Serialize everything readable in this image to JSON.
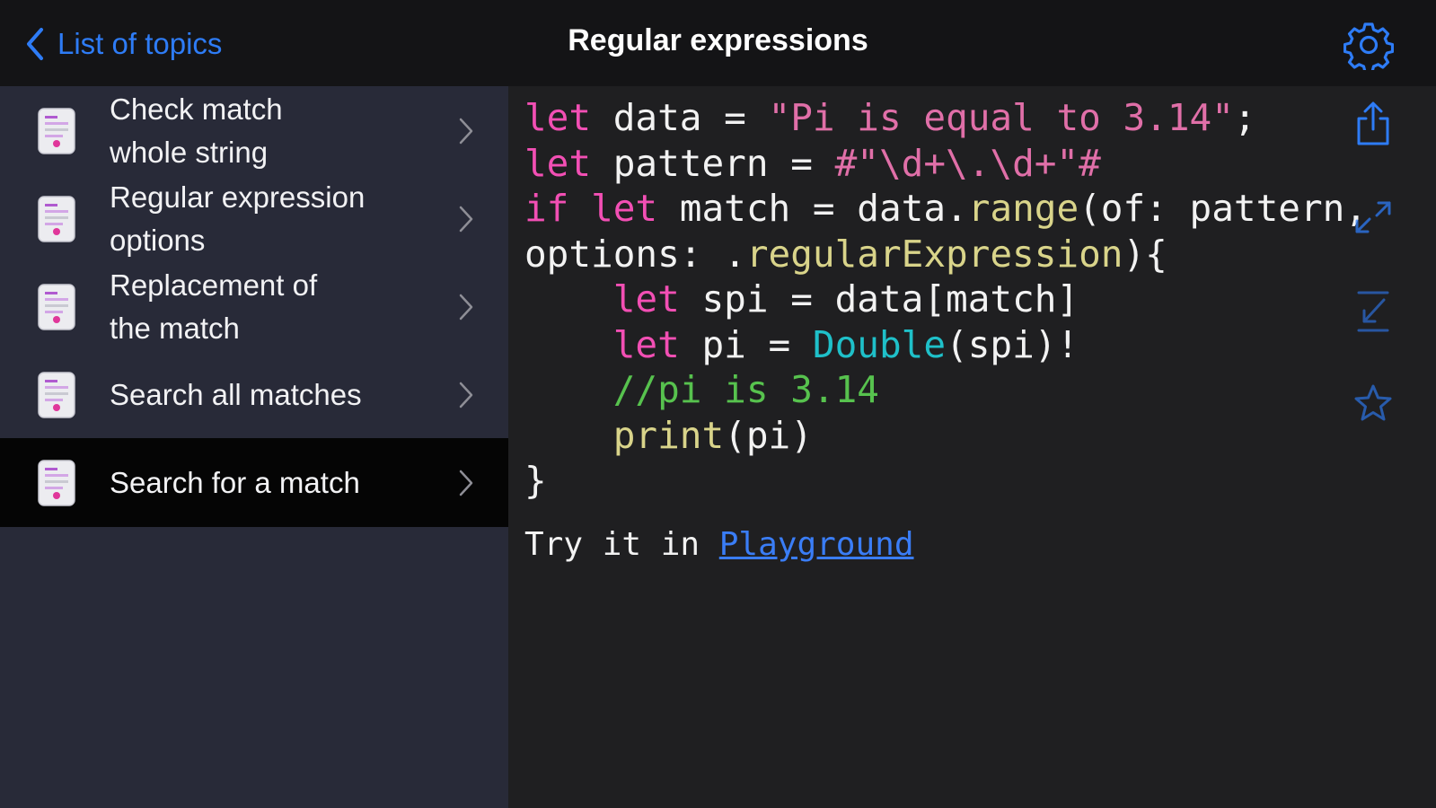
{
  "header": {
    "back_label": "List of topics",
    "title": "Regular expressions"
  },
  "sidebar": {
    "items": [
      {
        "line1": "Check match",
        "line2": "whole string",
        "selected": false
      },
      {
        "line1": "Regular expression",
        "line2": "options",
        "selected": false
      },
      {
        "line1": "Replacement of",
        "line2": "the match",
        "selected": false
      },
      {
        "line1": "Search all matches",
        "line2": "",
        "selected": false
      },
      {
        "line1": "Search for a match",
        "line2": "",
        "selected": true
      }
    ]
  },
  "code": {
    "lines": [
      [
        {
          "t": "let",
          "c": "kw"
        },
        {
          "t": " data = "
        },
        {
          "t": "\"Pi is equal to 3.14\"",
          "c": "str"
        },
        {
          "t": ";"
        }
      ],
      [
        {
          "t": "let",
          "c": "kw"
        },
        {
          "t": " pattern = "
        },
        {
          "t": "#\"\\d+\\.\\d+\"#",
          "c": "str"
        }
      ],
      [
        {
          "t": "if",
          "c": "kw"
        },
        {
          "t": " "
        },
        {
          "t": "let",
          "c": "kw"
        },
        {
          "t": " match = data."
        },
        {
          "t": "range",
          "c": "fn"
        },
        {
          "t": "(of: pattern,"
        }
      ],
      [
        {
          "t": "options: ."
        },
        {
          "t": "regularExpression",
          "c": "fn"
        },
        {
          "t": "){"
        }
      ],
      [
        {
          "t": "    "
        },
        {
          "t": "let",
          "c": "kw"
        },
        {
          "t": " spi = data[match]"
        }
      ],
      [
        {
          "t": "    "
        },
        {
          "t": "let",
          "c": "kw"
        },
        {
          "t": " pi = "
        },
        {
          "t": "Double",
          "c": "ty"
        },
        {
          "t": "(spi)!"
        }
      ],
      [
        {
          "t": "    "
        },
        {
          "t": "//pi is 3.14",
          "c": "cm"
        }
      ],
      [
        {
          "t": "    "
        },
        {
          "t": "print",
          "c": "fn"
        },
        {
          "t": "(pi)"
        }
      ],
      [
        {
          "t": "}"
        }
      ]
    ]
  },
  "footer": {
    "try_prefix": "Try it in ",
    "try_link": "Playground"
  },
  "icons": {
    "settings": "gear-icon",
    "share": "share-icon",
    "expand": "expand-arrows-icon",
    "collapse": "collapse-arrows-icon",
    "favorite": "star-icon",
    "back": "chevron-left-icon",
    "topic": "code-document-icon"
  },
  "colors": {
    "accent": "#2e7cf6",
    "keyword": "#f24fb4",
    "string": "#e06fa8",
    "function": "#d9d48a",
    "type": "#1fc0c9",
    "comment": "#57c24e"
  }
}
